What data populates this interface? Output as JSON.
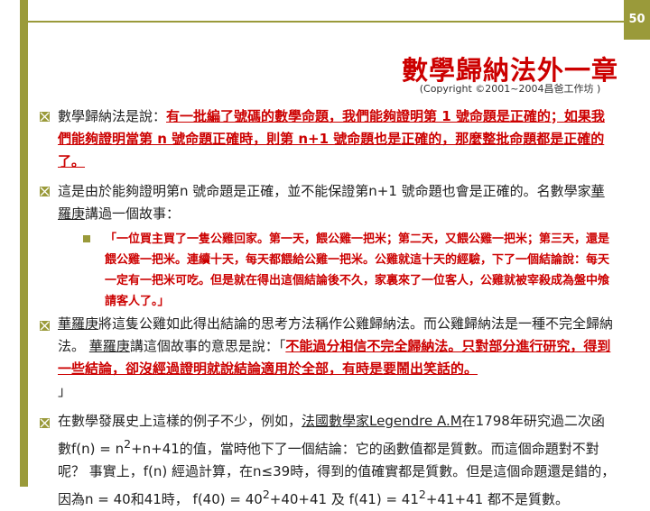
{
  "slide": {
    "page_number": "50"
  },
  "header": {
    "title": "數學歸納法外一章",
    "copyright": "(Copyright ©2001~2004昌爸工作坊 )"
  },
  "bullets": [
    {
      "pre": "數學歸納法是說：",
      "emph": "有一批編了號碼的數學命題，我們能夠證明第 1 號命題是正確的；如果我們能夠證明當第 n 號命題正確時，則第 n+1 號命題也是正確的，那麼整批命題都是正確的了。"
    },
    {
      "text": "這是由於能夠證明第n 號命題是正確，並不能保證第n+1 號命題也會是正確的。名數學家",
      "name": "華羅庚",
      "post": "講過一個故事："
    },
    {
      "sub_text": "「一位買主買了一隻公雞回家。第一天，餵公雞一把米；第二天，又餵公雞一把米；第三天，還是餵公雞一把米。連續十天，每天都餵給公雞一把米。公雞就這十天的經驗，下了一個結論說：每天一定有一把米可吃。但是就在得出這個結論後不久，家裏來了一位客人，公雞就被宰殺成為盤中飧請客人了。」"
    },
    {
      "name": "華羅庚",
      "pre": "將這隻公雞如此得出結論的思考方法稱作公雞歸納法。而公雞歸納法是一種不完全歸納法。",
      "name2": "華羅庚",
      "mid": "講這個故事的意思是說：「",
      "emph": "不能過分相信不完全歸納法。只對部分進行研究，得到一些結論，卻沒經過證明就說結論適用於全部，有時是要鬧出笑話的。",
      "post": "」"
    },
    {
      "pre": "在數學發展史上這樣的例子不少，例如，",
      "link": "法國數學家Legendre A.M",
      "mid": "在1798年研究過二次函數f(n) = n",
      "sup": "2",
      "mid2": "+n+41的值，當時他下了一個結論：它的函數值都是質數。而這個命題對不對呢？ 事實上，f(n) 經過計算，在n≤39時，得到的值確實都是質數。但是這個命題還是錯的，因為n = 40和41時， f(40) = 40",
      "sup2": "2",
      "mid3": "+40+41 及 f(41) = 41",
      "sup3": "2",
      "tail": "+41+41 都不是質數。"
    }
  ],
  "colors": {
    "accent": "#9a9a3a",
    "emphasis": "#cc0000",
    "text": "#222222"
  }
}
